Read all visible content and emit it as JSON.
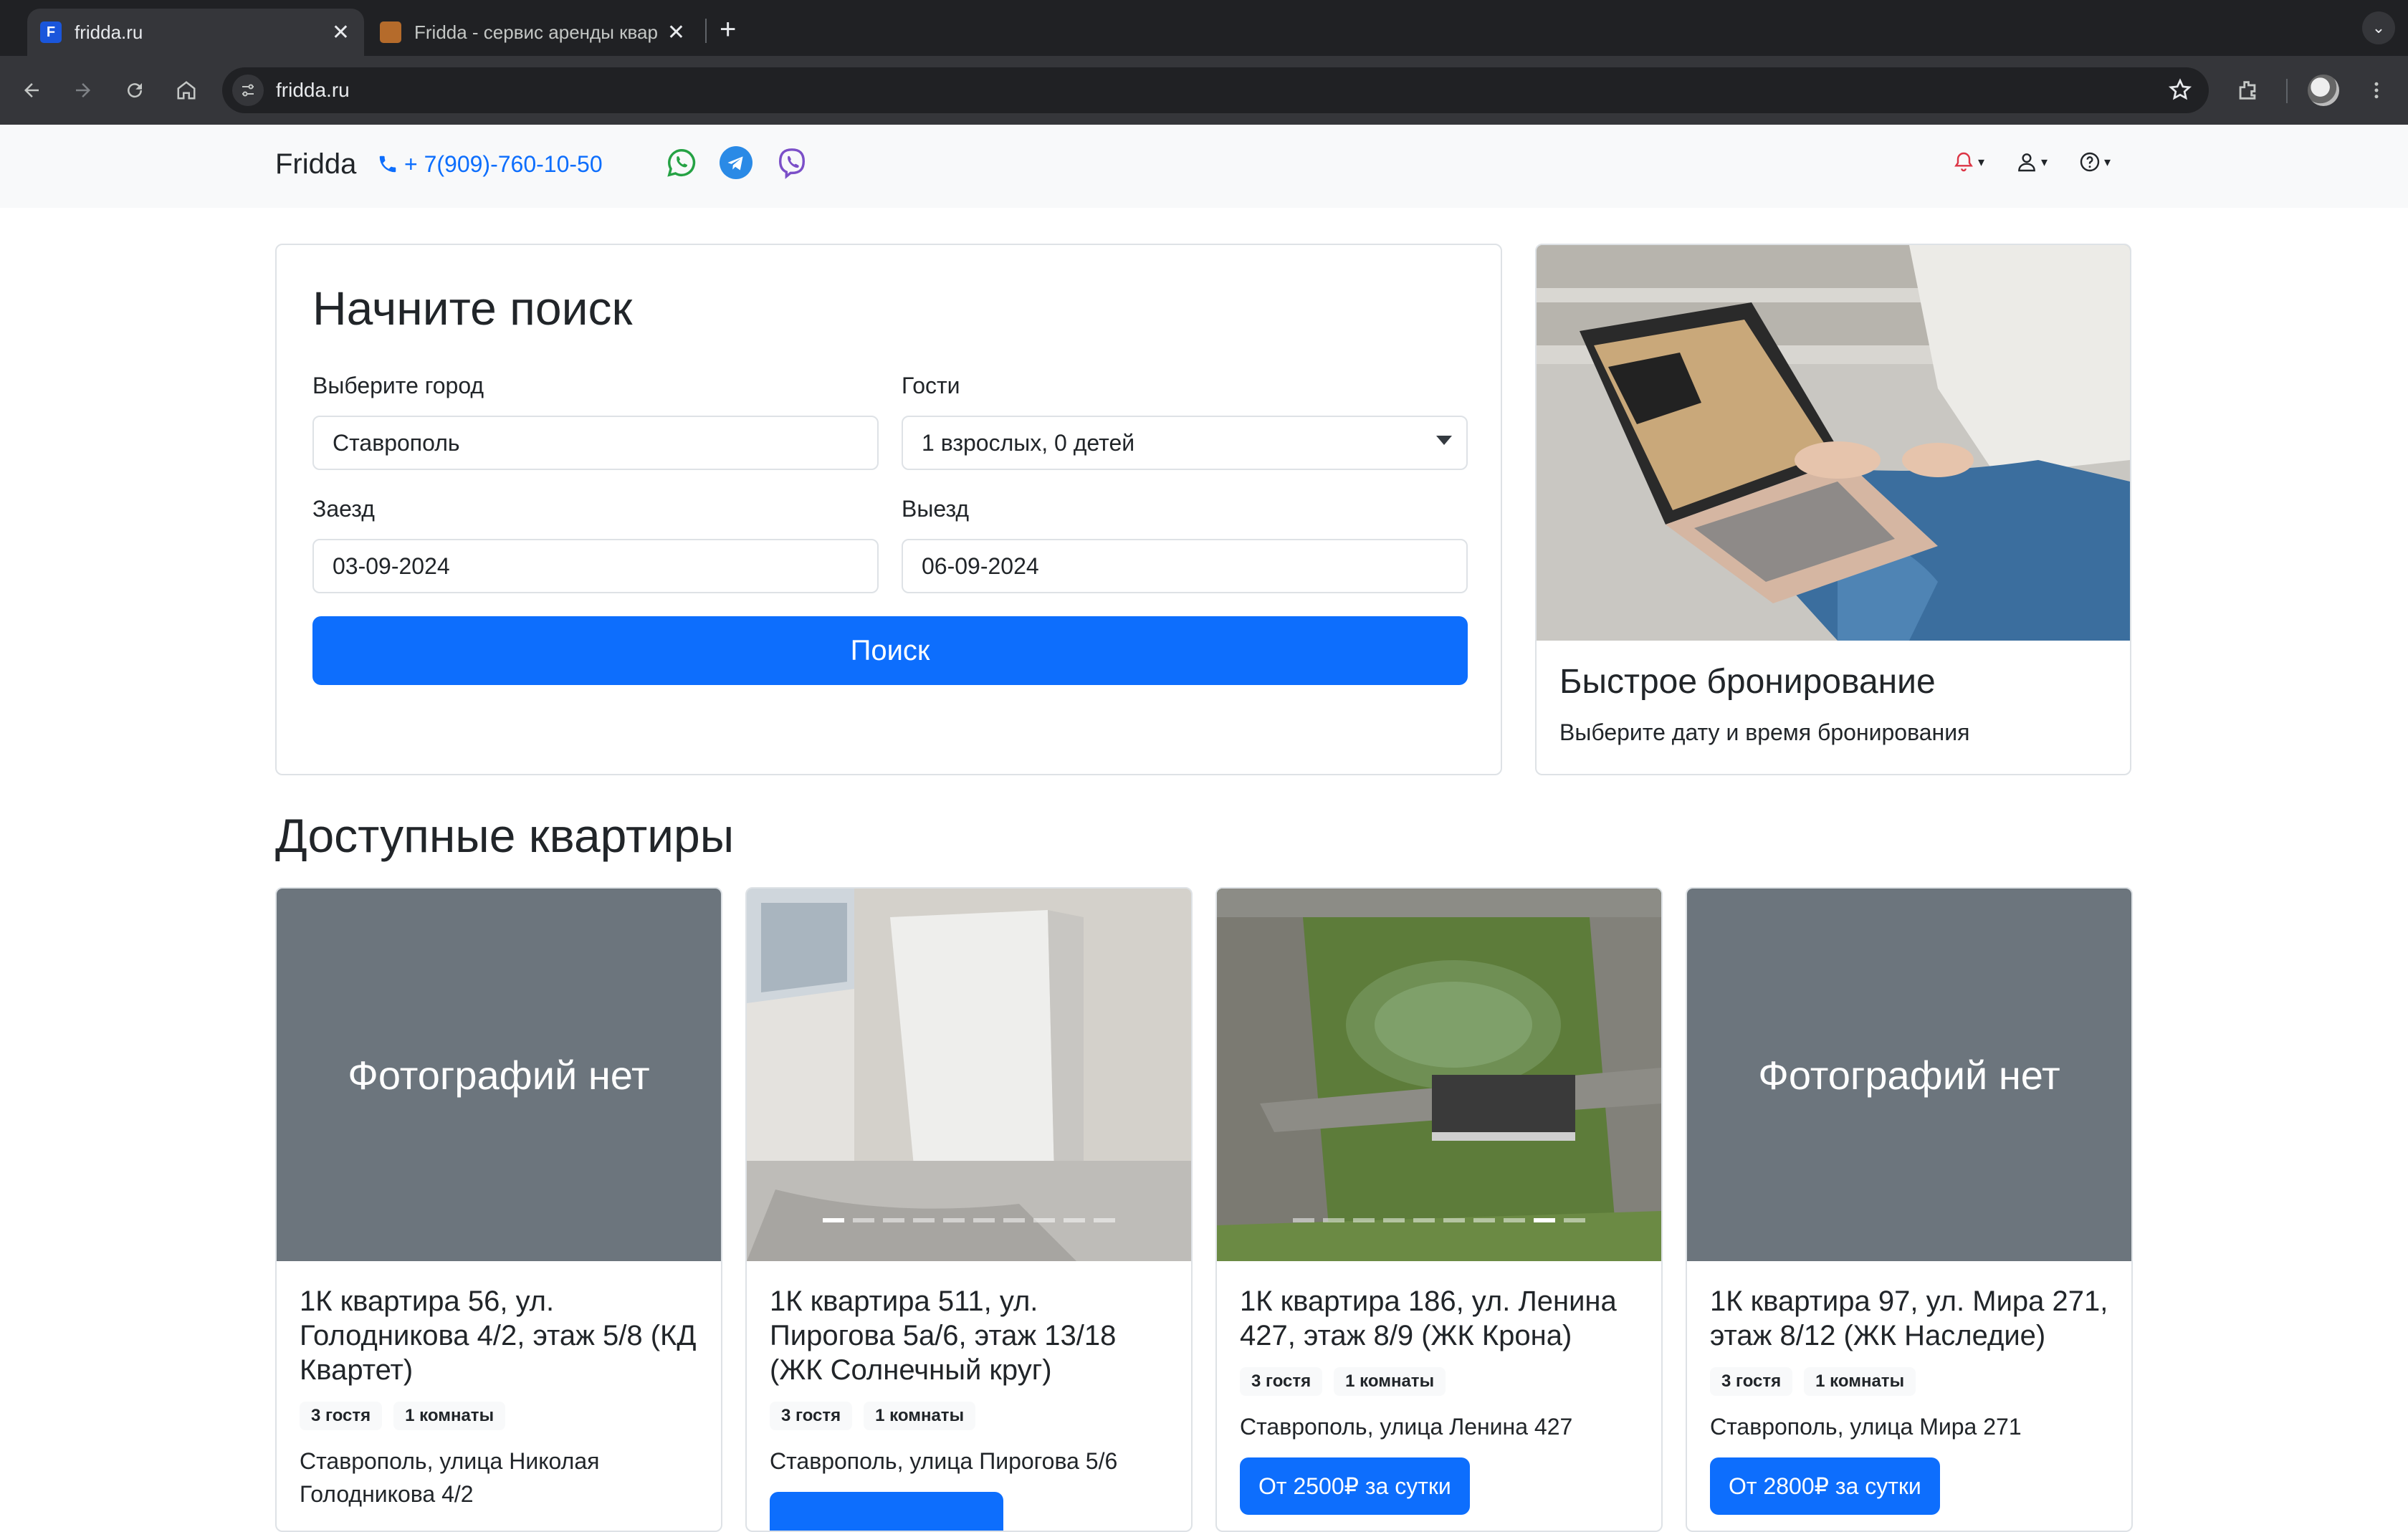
{
  "browser": {
    "tabs": [
      {
        "title": "fridda.ru",
        "favicon_letter": "F",
        "active": true
      },
      {
        "title": "Fridda - сервис аренды квар",
        "active": false
      }
    ],
    "url": "fridda.ru"
  },
  "header": {
    "brand": "Fridda",
    "phone": "+ 7(909)-760-10-50",
    "messengers": [
      "whatsapp-icon",
      "telegram-icon",
      "viber-icon"
    ]
  },
  "search": {
    "title": "Начните поиск",
    "city_label": "Выберите город",
    "city_value": "Ставрополь",
    "guests_label": "Гости",
    "guests_value": "1 взрослых, 0 детей",
    "checkin_label": "Заезд",
    "checkin_value": "03-09-2024",
    "checkout_label": "Выезд",
    "checkout_value": "06-09-2024",
    "button": "Поиск"
  },
  "promo": {
    "title": "Быстрое бронирование",
    "text": "Выберите дату и время бронирования"
  },
  "listings": {
    "title": "Доступные квартиры",
    "items": [
      {
        "photo_text": "Фотографий нет",
        "title": "1К квартира 56, ул. Голодникова 4/2, этаж 5/8 (КД Квартет)",
        "guests": "3 гостя",
        "rooms": "1 комнаты",
        "address": "Ставрополь, улица Николая Голодникова 4/2",
        "price": ""
      },
      {
        "photo_text": "",
        "title": "1К квартира 511, ул. Пирогова 5а/6, этаж 13/18 (ЖК Солнечный круг)",
        "guests": "3 гостя",
        "rooms": "1 комнаты",
        "address": "Ставрополь, улица Пирогова 5/6",
        "price": ""
      },
      {
        "photo_text": "",
        "title": "1К квартира 186, ул. Ленина 427, этаж 8/9 (ЖК Крона)",
        "guests": "3 гостя",
        "rooms": "1 комнаты",
        "address": "Ставрополь, улица Ленина 427",
        "price": "От 2500₽ за сутки"
      },
      {
        "photo_text": "Фотографий нет",
        "title": "1К квартира 97, ул. Мира 271, этаж 8/12 (ЖК Наследие)",
        "guests": "3 гостя",
        "rooms": "1 комнаты",
        "address": "Ставрополь, улица Мира 271",
        "price": "От 2800₽ за сутки"
      }
    ]
  },
  "colors": {
    "primary": "#0d6efd",
    "placeholder_gray": "#6c757d",
    "nav_bg": "#f8f9fa"
  }
}
